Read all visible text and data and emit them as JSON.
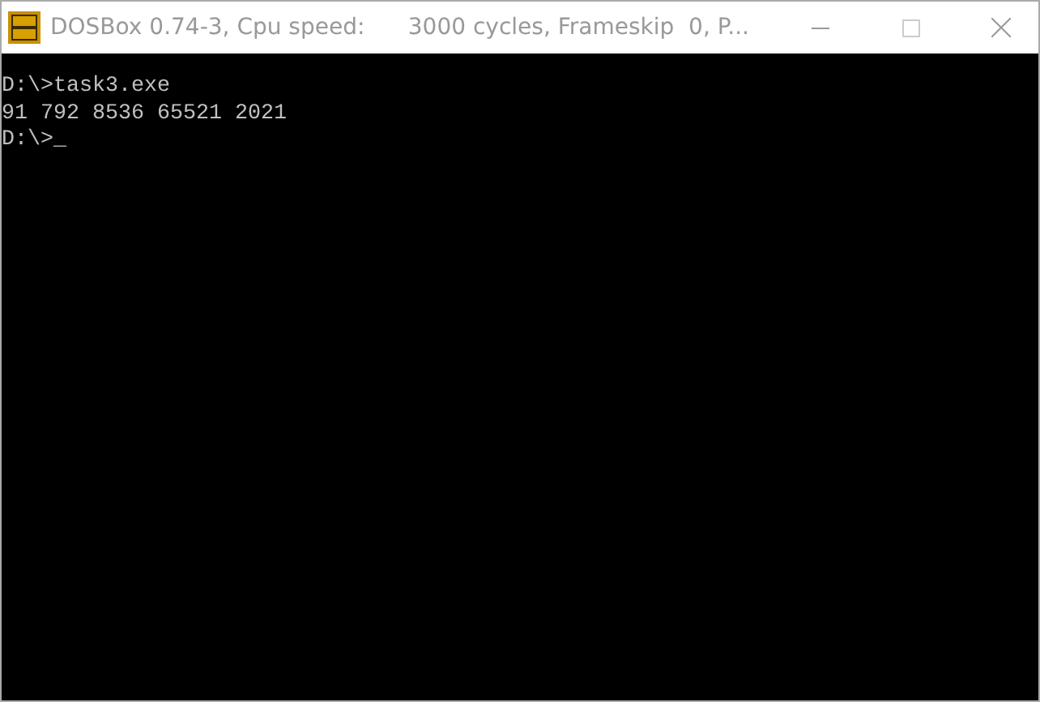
{
  "window": {
    "title": "DOSBox 0.74-3, Cpu speed:      3000 cycles, Frameskip  0, P...",
    "active": false
  },
  "console": {
    "lines": [
      "D:\\>task3.exe",
      "91 792 8536 65521 2021"
    ],
    "prompt": "D:\\>",
    "cursor": "_"
  }
}
